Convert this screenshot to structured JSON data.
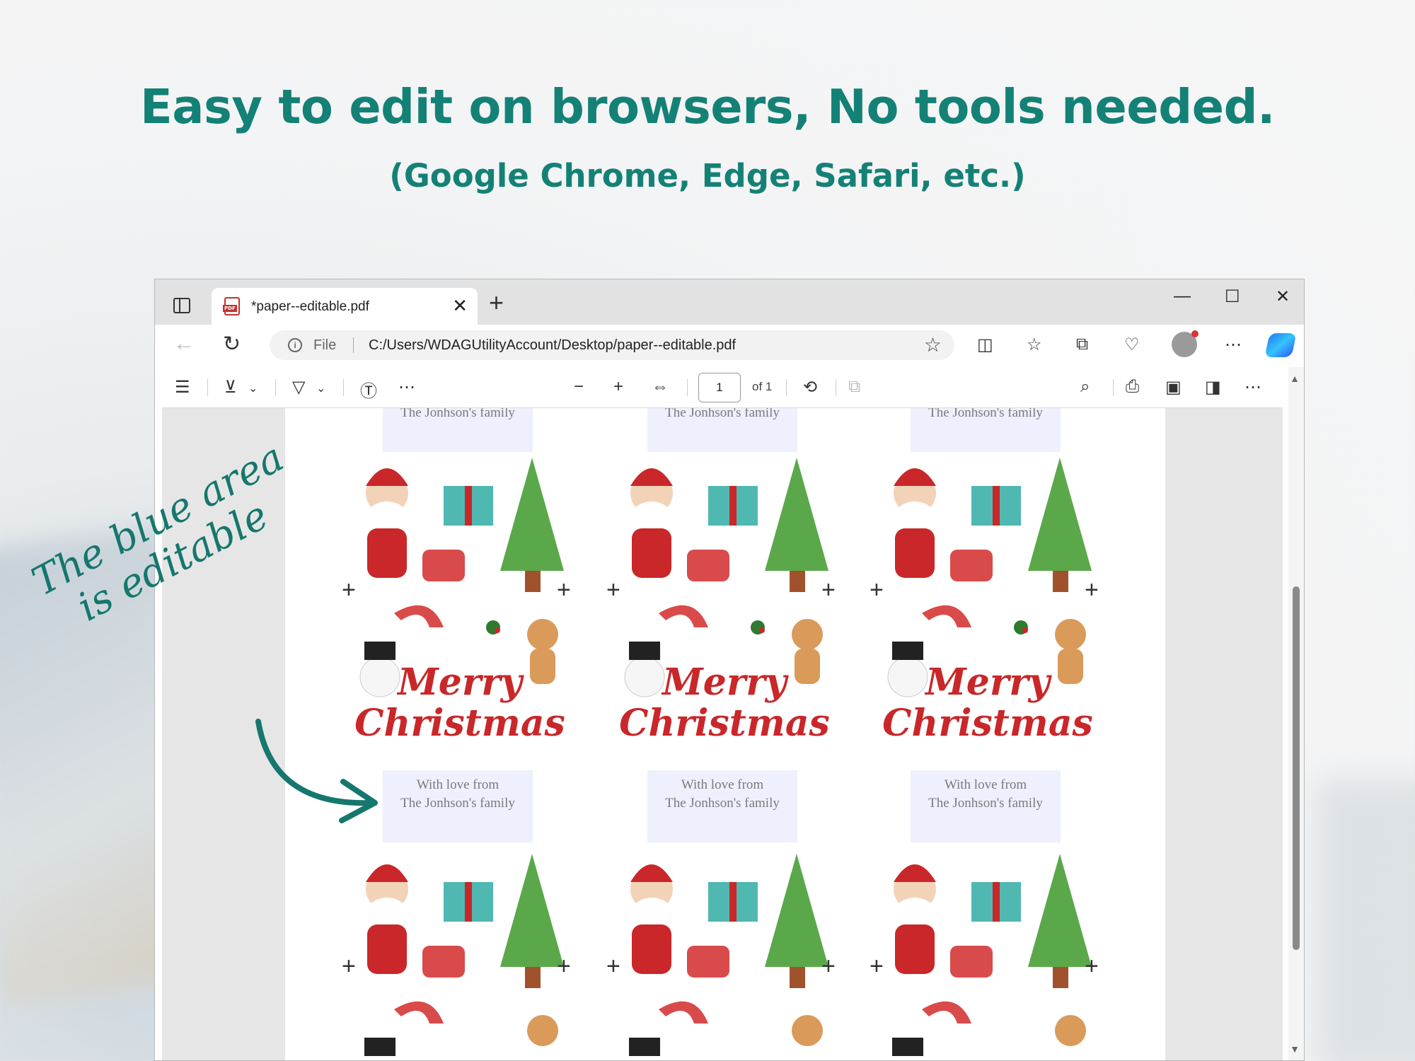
{
  "headline": "Easy to edit on browsers, No tools needed.",
  "subheadline": "(Google Chrome, Edge, Safari, etc.)",
  "annotation": {
    "line1": "The blue area",
    "line2": "is editable"
  },
  "browser": {
    "tab_title": "*paper--editable.pdf",
    "tab_close": "✕",
    "new_tab": "+",
    "window_controls": {
      "minimize": "—",
      "maximize": "☐",
      "close": "✕"
    },
    "address": {
      "scheme_label": "File",
      "url": "C:/Users/WDAGUtilityAccount/Desktop/paper--editable.pdf"
    },
    "pdf_toolbar": {
      "page_number": "1",
      "page_total": "of 1"
    }
  },
  "document": {
    "card_text_line1": "With love from",
    "card_text_line2": "The Jonhson's family",
    "greeting_line1": "Merry",
    "greeting_line2": "Christmas"
  },
  "colors": {
    "accent": "#148176",
    "greeting_red": "#c9272a",
    "editable_blue": "#eef0fd"
  },
  "icons": [
    "sidebar-icon",
    "pdf-icon",
    "back-icon",
    "refresh-icon",
    "info-icon",
    "favorite-star-icon",
    "split-screen-icon",
    "favorites-icon",
    "collections-icon",
    "browser-essentials-icon",
    "profile-avatar",
    "more-icon",
    "copilot-icon",
    "contents-icon",
    "draw-icon",
    "highlight-icon",
    "text-icon",
    "zoom-out-icon",
    "zoom-in-icon",
    "fit-width-icon",
    "rotate-icon",
    "page-view-icon",
    "search-icon",
    "print-icon",
    "save-icon",
    "save-as-icon"
  ]
}
